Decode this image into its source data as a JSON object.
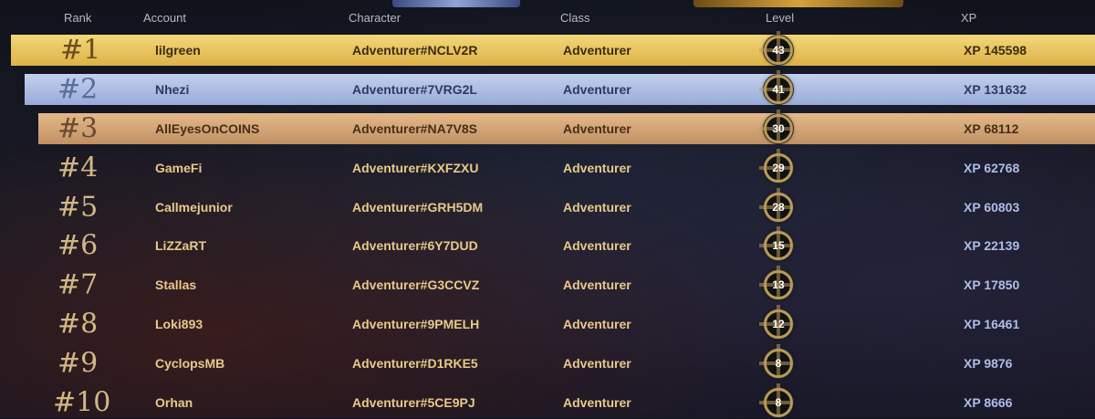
{
  "headers": {
    "rank": "Rank",
    "account": "Account",
    "character": "Character",
    "class": "Class",
    "level": "Level",
    "xp": "XP"
  },
  "rows": [
    {
      "rank": "#1",
      "account": "lilgreen",
      "character": "Adventurer#NCLV2R",
      "class": "Adventurer",
      "level": "43",
      "xp": "XP 145598"
    },
    {
      "rank": "#2",
      "account": "Nhezi",
      "character": "Adventurer#7VRG2L",
      "class": "Adventurer",
      "level": "41",
      "xp": "XP 131632"
    },
    {
      "rank": "#3",
      "account": "AllEyesOnCOINS",
      "character": "Adventurer#NA7V8S",
      "class": "Adventurer",
      "level": "30",
      "xp": "XP 68112"
    },
    {
      "rank": "#4",
      "account": "GameFi",
      "character": "Adventurer#KXFZXU",
      "class": "Adventurer",
      "level": "29",
      "xp": "XP 62768"
    },
    {
      "rank": "#5",
      "account": "Callmejunior",
      "character": "Adventurer#GRH5DM",
      "class": "Adventurer",
      "level": "28",
      "xp": "XP 60803"
    },
    {
      "rank": "#6",
      "account": "LiZZaRT",
      "character": "Adventurer#6Y7DUD",
      "class": "Adventurer",
      "level": "15",
      "xp": "XP 22139"
    },
    {
      "rank": "#7",
      "account": "Stallas",
      "character": "Adventurer#G3CCVZ",
      "class": "Adventurer",
      "level": "13",
      "xp": "XP 17850"
    },
    {
      "rank": "#8",
      "account": "Loki893",
      "character": "Adventurer#9PMELH",
      "class": "Adventurer",
      "level": "12",
      "xp": "XP 16461"
    },
    {
      "rank": "#9",
      "account": "CyclopsMB",
      "character": "Adventurer#D1RKE5",
      "class": "Adventurer",
      "level": "8",
      "xp": "XP 9876"
    },
    {
      "rank": "#10",
      "account": "Orhan",
      "character": "Adventurer#5CE9PJ",
      "class": "Adventurer",
      "level": "8",
      "xp": "XP 8666"
    }
  ],
  "colors": {
    "gold": "#e8c45c",
    "silver": "#aebde6",
    "bronze": "#d6a677",
    "text_gold": "#e8c98a",
    "text_xp": "#aebde8"
  }
}
